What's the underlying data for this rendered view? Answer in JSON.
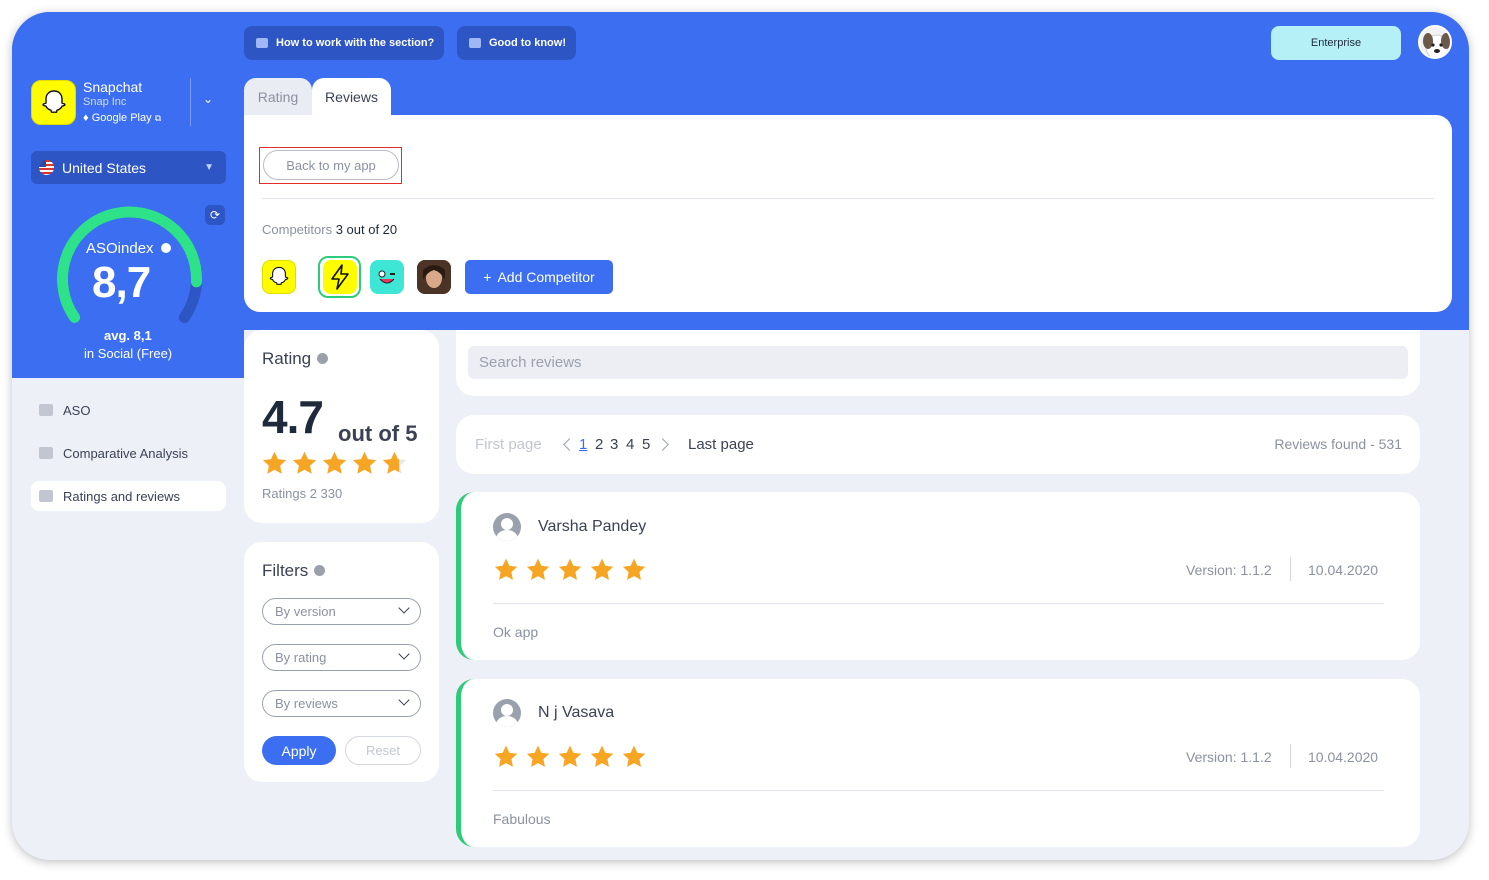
{
  "topbar": {
    "how_to_label": "How to work with the section?",
    "good_to_know_label": "Good to know!",
    "plan_label": "Enterprise"
  },
  "app": {
    "name": "Snapchat",
    "developer": "Snap Inc",
    "store": "Google Play"
  },
  "country": {
    "selected": "United States"
  },
  "aso_index": {
    "title": "ASOindex",
    "value": "8,7",
    "score": 8.7,
    "max": 10,
    "avg": "avg. 8,1",
    "category": "in Social (Free)"
  },
  "sidebar": {
    "items": [
      {
        "label": "ASO",
        "active": false
      },
      {
        "label": "Comparative Analysis",
        "active": false
      },
      {
        "label": "Ratings and reviews",
        "active": true
      }
    ]
  },
  "tabs": [
    {
      "label": "Rating",
      "active": false
    },
    {
      "label": "Reviews",
      "active": true
    }
  ],
  "competitors_panel": {
    "back_label": "Back to my app",
    "competitors_label": "Competitors",
    "competitors_count": "3 out of 20",
    "add_label": "Add Competitor",
    "icons": [
      "snapchat-icon",
      "lightning-app-icon",
      "wink-face-app-icon",
      "portrait-app-icon"
    ]
  },
  "rating": {
    "title": "Rating",
    "value": "4.7",
    "out_of": "out of 5",
    "stars": 4.7,
    "count_label": "Ratings 2 330"
  },
  "filters": {
    "title": "Filters",
    "selects": [
      "By version",
      "By rating",
      "By reviews"
    ],
    "apply_label": "Apply",
    "reset_label": "Reset"
  },
  "search": {
    "placeholder": "Search reviews"
  },
  "pagination": {
    "first_label": "First page",
    "pages": [
      "1",
      "2",
      "3",
      "4",
      "5"
    ],
    "current": "1",
    "last_label": "Last page",
    "found_label": "Reviews found - 531"
  },
  "reviews": [
    {
      "author": "Varsha Pandey",
      "stars": 5,
      "version": "Version: 1.1.2",
      "date": "10.04.2020",
      "text": "Ok app"
    },
    {
      "author": "N j Vasava",
      "stars": 5,
      "version": "Version: 1.1.2",
      "date": "10.04.2020",
      "text": "Fabulous"
    }
  ],
  "colors": {
    "brand_blue": "#3b6ef0",
    "accent_green": "#2ecb7a",
    "star": "#f6a623",
    "snapchat_yellow": "#fffc00"
  }
}
